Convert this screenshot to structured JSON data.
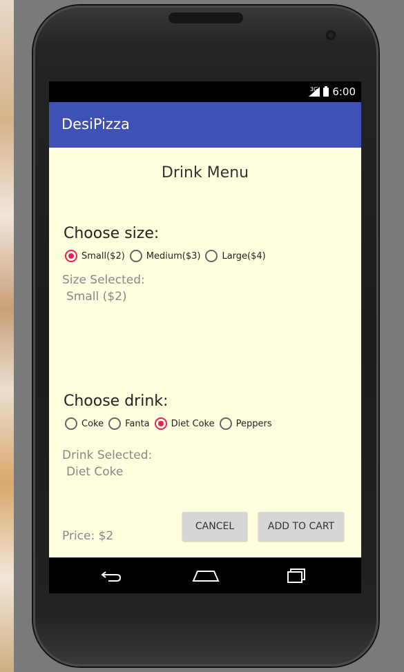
{
  "status_bar": {
    "network": "3G",
    "time": "6:00"
  },
  "app_bar": {
    "title": "DesiPizza"
  },
  "main": {
    "heading": "Drink Menu",
    "size_section": {
      "title": "Choose size:",
      "options": [
        {
          "label": "Small($2)",
          "checked": true
        },
        {
          "label": "Medium($3)",
          "checked": false
        },
        {
          "label": "Large($4)",
          "checked": false
        }
      ],
      "selected_label": "Size Selected:",
      "selected_value": "Small ($2)"
    },
    "drink_section": {
      "title": "Choose drink:",
      "options": [
        {
          "label": "Coke",
          "checked": false
        },
        {
          "label": "Fanta",
          "checked": false
        },
        {
          "label": "Diet Coke",
          "checked": true
        },
        {
          "label": "Peppers",
          "checked": false
        }
      ],
      "selected_label": "Drink Selected:",
      "selected_value": "Diet Coke"
    },
    "price": "Price: $2",
    "buttons": {
      "cancel": "CANCEL",
      "add_to_cart": "ADD TO CART"
    }
  },
  "nav_bar": {
    "icons": [
      "back-icon",
      "home-icon",
      "recents-icon"
    ]
  },
  "colors": {
    "app_bar": "#3f51b5",
    "content_bg": "#ffffe0",
    "accent": "#e91e63"
  }
}
